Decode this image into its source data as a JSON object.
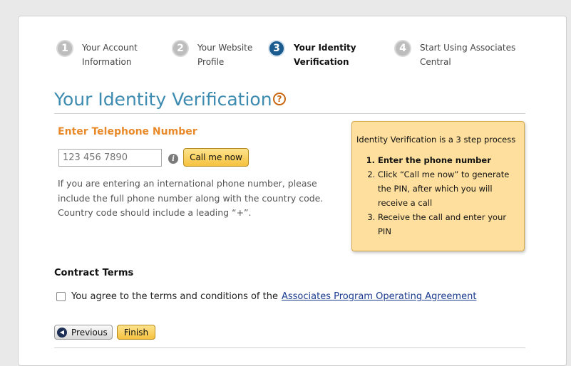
{
  "steps": [
    {
      "num": "1",
      "line1": "Your Account",
      "line2": "Information"
    },
    {
      "num": "2",
      "line1": "Your Website",
      "line2": "Profile"
    },
    {
      "num": "3",
      "line1": "Your Identity",
      "line2": "Verification"
    },
    {
      "num": "4",
      "line1": "Start Using Associates",
      "line2": "Central"
    }
  ],
  "page_title": "Your Identity Verification",
  "help_icon": "?",
  "phone": {
    "heading": "Enter Telephone Number",
    "placeholder": "123 456 7890",
    "info_icon": "i",
    "call_button": "Call me now",
    "note": "If you are entering an international phone number, please include the full phone number along with the country code. Country code should include a leading “+”."
  },
  "callout": {
    "intro": "Identity Verification is a 3 step process",
    "items": [
      "Enter the phone number",
      "Click “Call me now” to generate the PIN, after which you will receive a call",
      "Receive the call and enter your PIN"
    ]
  },
  "contract": {
    "heading": "Contract Terms",
    "agree_text": "You agree to the terms and conditions of the",
    "agreement_link": "Associates Program Operating Agreement"
  },
  "nav": {
    "previous": "Previous",
    "finish": "Finish"
  },
  "colors": {
    "title": "#3d8bb0",
    "section_heading": "#e88a2a",
    "active_step": "#1a5c8f",
    "callout_bg": "#fedf9d"
  }
}
